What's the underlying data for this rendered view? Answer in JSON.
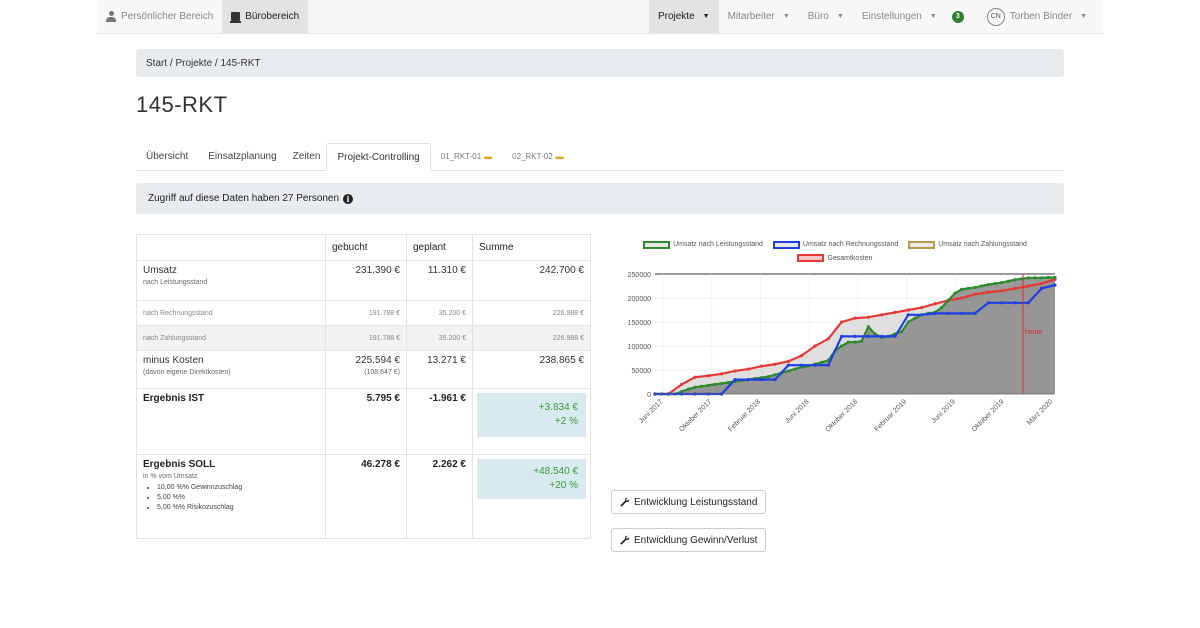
{
  "nav": {
    "personal": "Persönlicher Bereich",
    "office": "Bürobereich",
    "projects": "Projekte",
    "employees": "Mitarbeiter",
    "buero": "Büro",
    "settings": "Einstellungen",
    "notification_count": "3",
    "user_initials": "CN",
    "user_name": "Torben Binder"
  },
  "breadcrumb": "Start / Projekte / 145-RKT",
  "page_title": "145-RKT",
  "tabs": [
    {
      "label": "Übersicht"
    },
    {
      "label": "Einsatzplanung"
    },
    {
      "label": "Zeiten"
    },
    {
      "label": "Projekt-Controlling"
    },
    {
      "label": "01_RKT-01"
    },
    {
      "label": "02_RKT-02"
    }
  ],
  "access_text": "Zugriff auf diese Daten haben 27 Personen",
  "table": {
    "headers": {
      "label": "",
      "booked": "gebucht",
      "planned": "geplant",
      "sum": "Summe"
    },
    "umsatz": {
      "label": "Umsatz",
      "sub": "nach Leistungsstand",
      "booked": "231.390 €",
      "planned": "11.310 €",
      "sum": "242.700 €"
    },
    "rechnung": {
      "label": "nach Rechnungsstand",
      "booked": "191.788 €",
      "planned": "35.200 €",
      "sum": "226.988 €"
    },
    "zahlung": {
      "label": "nach Zahlungsstand",
      "booked": "191.788 €",
      "planned": "35.200 €",
      "sum": "226.988 €"
    },
    "kosten": {
      "label": "minus Kosten",
      "sub": "(davon eigene Direktkosten)",
      "booked": "225.594 €",
      "booked_sub": "(108.647 €)",
      "planned": "13.271 €",
      "sum": "238.865 €"
    },
    "ist": {
      "label": "Ergebnis IST",
      "booked": "5.795 €",
      "planned": "-1.961 €",
      "sum": "+3.834 €",
      "sum_pct": "+2 %"
    },
    "soll": {
      "label": "Ergebnis SOLL",
      "sub": "in % vom Umsatz",
      "items": [
        "10,00 %% Gewinnzuschlag",
        "5,00 %%",
        "5,00 %% Risikozuschlag"
      ],
      "booked": "46.278 €",
      "planned": "2.262 €",
      "sum": "+48.540 €",
      "sum_pct": "+20 %"
    }
  },
  "buttons": {
    "leistung": "Entwicklung Leistungsstand",
    "gewinn": "Entwicklung Gewinn/Verlust"
  },
  "colors": {
    "leistung": "#2e8b2e",
    "rechnung": "#1f3fe0",
    "zahlung": "#b89a4a",
    "kosten": "#e53935",
    "today": "#d32f2f"
  },
  "chart_data": {
    "type": "line",
    "legend": [
      "Umsatz nach Leistungsstand",
      "Umsatz nach Rechnungsstand",
      "Umsatz nach Zahlungsstand",
      "Gesamtkosten"
    ],
    "x_ticks": [
      "Juni 2017",
      "Oktober 2017",
      "Februar 2018",
      "Juni 2018",
      "Oktober 2018",
      "Februar 2019",
      "Juni 2019",
      "Oktober 2019",
      "März 2020"
    ],
    "y_ticks": [
      "0",
      "50000",
      "100000",
      "150000",
      "200000",
      "250000"
    ],
    "ylim": [
      0,
      250000
    ],
    "today_label": "heute",
    "today_x": 3.9,
    "series": [
      {
        "name": "Umsatz nach Leistungsstand",
        "x": [
          0,
          0.25,
          0.5,
          0.75,
          1,
          1.25,
          1.5,
          1.75,
          2,
          2.25,
          2.5,
          2.75,
          3,
          3.25,
          3.5,
          3.75,
          4,
          4.25,
          4.5,
          4.75,
          5,
          5.25,
          5.5,
          5.75,
          6,
          6.25,
          6.5,
          6.75,
          7,
          7.25,
          7.5,
          7.75,
          8,
          8.25,
          8.5,
          8.75,
          9,
          9.25,
          9.5,
          9.75,
          10,
          10.25,
          10.5,
          10.75,
          11,
          11.25,
          11.5,
          11.75,
          12,
          12.25,
          12.5,
          12.75,
          13,
          13.25,
          13.5,
          13.75,
          14,
          14.25,
          14.5,
          14.75,
          15
        ],
        "y": [
          0,
          0,
          0,
          0,
          5000,
          10000,
          14000,
          16000,
          18000,
          20000,
          22000,
          24000,
          26000,
          28000,
          30000,
          32000,
          34000,
          36000,
          40000,
          44000,
          48000,
          52000,
          56000,
          58000,
          62000,
          66000,
          70000,
          90000,
          100000,
          108000,
          108000,
          110000,
          140000,
          125000,
          118000,
          120000,
          125000,
          130000,
          150000,
          158000,
          165000,
          168000,
          170000,
          180000,
          195000,
          210000,
          218000,
          220000,
          222000,
          225000,
          228000,
          230000,
          232000,
          235000,
          238000,
          240000,
          242000,
          242000,
          242000,
          242700,
          242700
        ]
      },
      {
        "name": "Umsatz nach Rechnungsstand",
        "x": [
          0,
          0.5,
          1,
          1.5,
          2,
          2.5,
          3,
          3.5,
          4,
          4.5,
          5,
          5.5,
          6,
          6.5,
          7,
          7.5,
          8,
          8.5,
          9,
          9.5,
          10,
          10.5,
          11,
          11.5,
          12,
          12.5,
          13,
          13.5,
          14,
          14.5,
          15
        ],
        "y": [
          0,
          0,
          0,
          0,
          0,
          0,
          30000,
          30000,
          30000,
          30000,
          60000,
          60000,
          60000,
          60000,
          120000,
          120000,
          120000,
          120000,
          120000,
          165000,
          165000,
          168000,
          168000,
          168000,
          168000,
          190000,
          190000,
          190000,
          190000,
          220000,
          226988
        ]
      },
      {
        "name": "Gesamtkosten",
        "x": [
          0,
          0.5,
          1,
          1.5,
          2,
          2.5,
          3,
          3.5,
          4,
          4.5,
          5,
          5.5,
          6,
          6.5,
          7,
          7.5,
          8,
          8.5,
          9,
          9.5,
          10,
          10.5,
          11,
          11.5,
          12,
          12.5,
          13,
          13.5,
          14,
          14.5,
          15
        ],
        "y": [
          0,
          0,
          20000,
          35000,
          38000,
          42000,
          48000,
          52000,
          58000,
          62000,
          68000,
          80000,
          100000,
          115000,
          150000,
          158000,
          160000,
          165000,
          170000,
          175000,
          180000,
          188000,
          195000,
          200000,
          208000,
          212000,
          215000,
          220000,
          225000,
          230000,
          238865
        ]
      }
    ]
  }
}
